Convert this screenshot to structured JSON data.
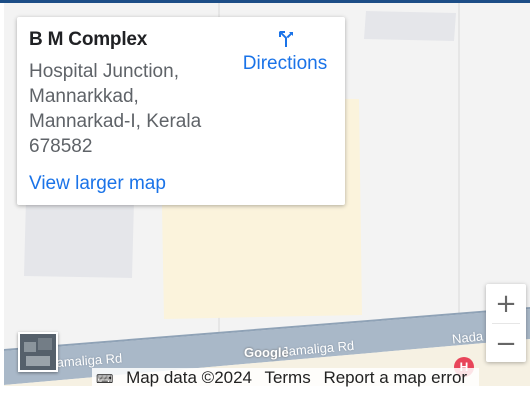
{
  "map": {
    "place": {
      "name": "B M Complex",
      "address": "Hospital Junction, Mannarkkad, Mannarkad-I, Kerala 678582"
    },
    "directions_label": "Directions",
    "larger_map_label": "View larger map",
    "zoom_in_label": "+",
    "zoom_out_label": "−",
    "roads": [
      "Jamaliga Rd",
      "Jamaliga Rd",
      "Nada"
    ],
    "logo_text": "Google",
    "attribution": {
      "keyboard_icon": "keyboard-icon",
      "data": "Map data ©2024",
      "terms": "Terms",
      "report": "Report a map error"
    },
    "poi_icon": "hospital-icon",
    "poi_label": "H",
    "colors": {
      "road": "#a9b8c8",
      "land": "#f3f3f3",
      "building": "#e5e6ea",
      "area": "#fbf3dc",
      "link": "#1a73e8"
    }
  }
}
